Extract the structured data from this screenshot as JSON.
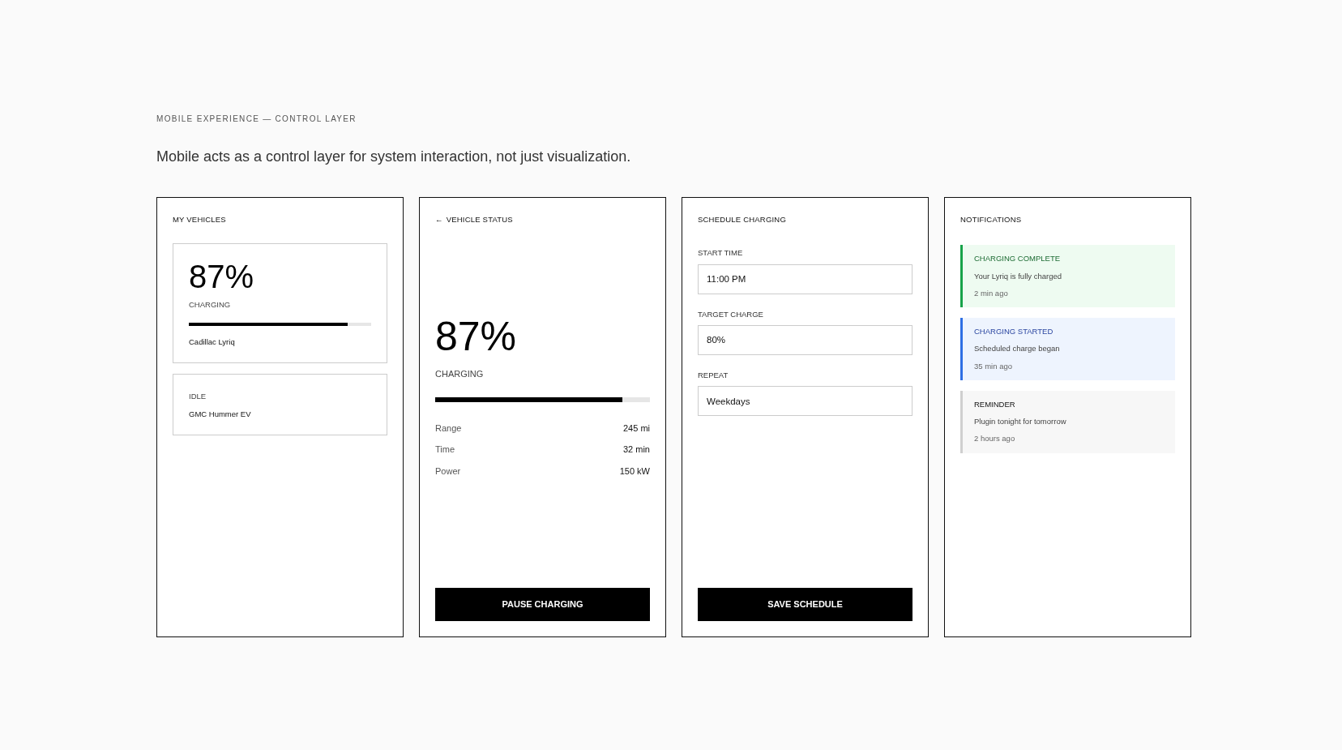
{
  "eyebrow": "MOBILE EXPERIENCE — CONTROL LAYER",
  "headline": "Mobile acts as a control layer for system interaction, not just visualization.",
  "screens": [
    {
      "kind": "vehicles",
      "title": "MY VEHICLES",
      "vehicles": [
        {
          "percent": "87%",
          "status": "CHARGING",
          "level": 0.87,
          "name": "Cadillac Lyriq"
        },
        {
          "status": "IDLE",
          "name": "GMC Hummer EV"
        }
      ]
    },
    {
      "kind": "status",
      "back_icon": "←",
      "title": "VEHICLE STATUS",
      "percent": "87%",
      "status": "CHARGING",
      "level": 0.87,
      "stats": [
        {
          "label": "Range",
          "value": "245 mi"
        },
        {
          "label": "Time",
          "value": "32 min"
        },
        {
          "label": "Power",
          "value": "150 kW"
        }
      ],
      "button": "PAUSE CHARGING"
    },
    {
      "kind": "schedule",
      "title": "SCHEDULE CHARGING",
      "fields": [
        {
          "label": "START TIME",
          "value": "11:00 PM"
        },
        {
          "label": "TARGET CHARGE",
          "value": "80%"
        },
        {
          "label": "REPEAT",
          "value": "Weekdays"
        }
      ],
      "button": "SAVE SCHEDULE"
    },
    {
      "kind": "notifications",
      "title": "NOTIFICATIONS",
      "notifications": [
        {
          "kind": "success",
          "title": "CHARGING COMPLETE",
          "message": "Your Lyriq is fully charged",
          "time": "2 min ago"
        },
        {
          "kind": "info",
          "title": "CHARGING STARTED",
          "message": "Scheduled charge began",
          "time": "35 min ago"
        },
        {
          "kind": "neutral",
          "title": "REMINDER",
          "message": "Plugin tonight for tomorrow",
          "time": "2 hours ago"
        }
      ]
    }
  ]
}
